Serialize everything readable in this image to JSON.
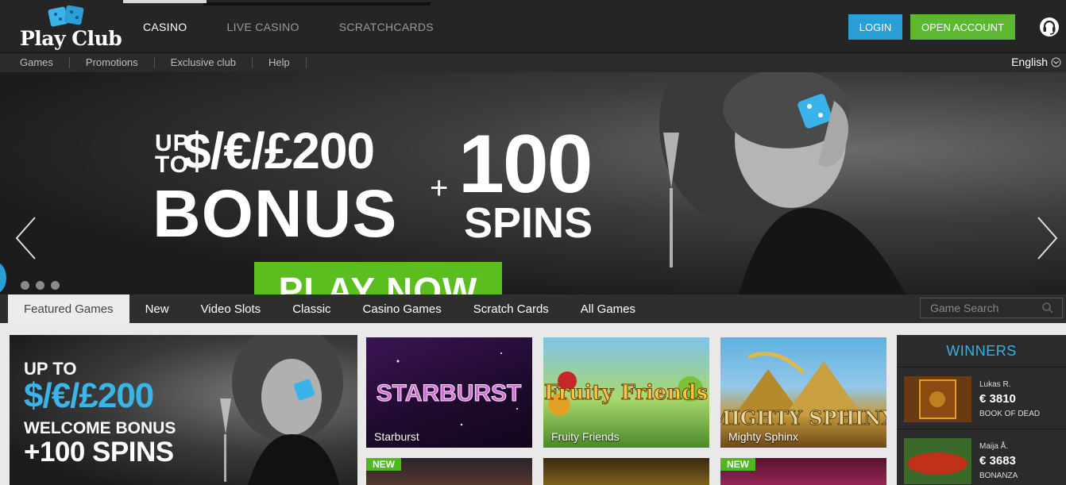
{
  "header": {
    "logo_text": "Play Club",
    "tabs": [
      {
        "label": "CASINO",
        "active": true
      },
      {
        "label": "LIVE CASINO",
        "active": false
      },
      {
        "label": "SCRATCHCARDS",
        "active": false
      }
    ],
    "login_label": "LOGIN",
    "open_account_label": "OPEN ACCOUNT",
    "support_icon": "headset-icon"
  },
  "subnav": {
    "items": [
      "Games",
      "Promotions",
      "Exclusive club",
      "Help"
    ],
    "language": "English"
  },
  "hero": {
    "up_to": "UP TO",
    "amount": "$/€/£200",
    "bonus": "BONUS",
    "plus": "+",
    "spins_count": "100",
    "spins": "SPINS",
    "cta": "PLAY NOW",
    "slide_count": 3
  },
  "game_tabs": {
    "tabs": [
      {
        "label": "Featured Games",
        "active": true
      },
      {
        "label": "New",
        "active": false
      },
      {
        "label": "Video Slots",
        "active": false
      },
      {
        "label": "Classic",
        "active": false
      },
      {
        "label": "Casino Games",
        "active": false
      },
      {
        "label": "Scratch Cards",
        "active": false
      },
      {
        "label": "All Games",
        "active": false
      }
    ],
    "search_placeholder": "Game Search"
  },
  "promo": {
    "up_to": "UP TO",
    "amount": "$/€/£200",
    "welcome": "WELCOME BONUS",
    "spins": "+100 SPINS"
  },
  "games": [
    {
      "name": "Starburst",
      "art_title": "STARBURST"
    },
    {
      "name": "Fruity Friends",
      "art_title": "Fruity Friends"
    },
    {
      "name": "Mighty Sphinx",
      "art_title": "MIGHTY SPHINX"
    }
  ],
  "new_badge": "NEW",
  "winners": {
    "title": "WINNERS",
    "list": [
      {
        "name": "Lukas R.",
        "amount": "€ 3810",
        "game": "BOOK OF DEAD"
      },
      {
        "name": "Maija Å.",
        "amount": "€ 3683",
        "game": "BONANZA"
      }
    ]
  },
  "colors": {
    "accent_blue": "#2a9fd6",
    "accent_green": "#5cb82f",
    "winners_title": "#39b1e6"
  }
}
